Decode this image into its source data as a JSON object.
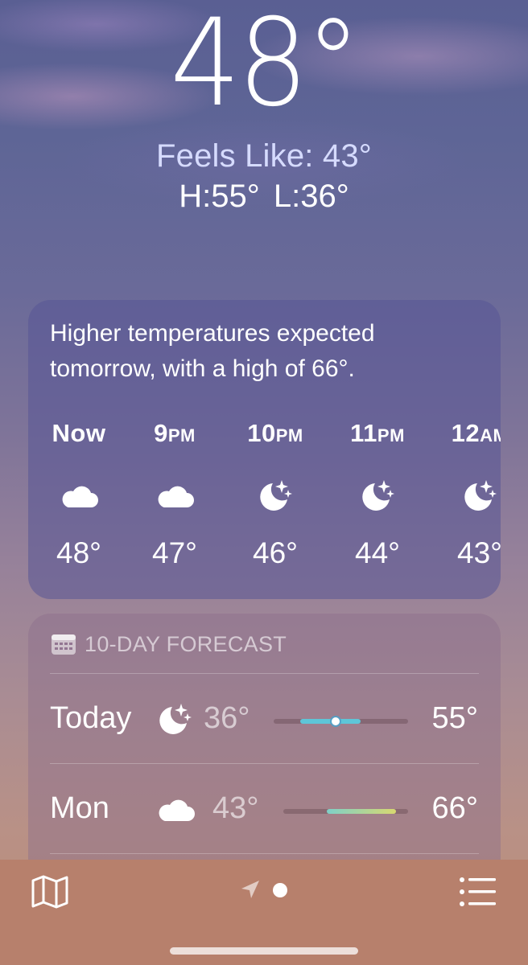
{
  "current": {
    "temperature": "48°",
    "feels_like": "Feels Like: 43°",
    "high_low": "H:55°  L:36°"
  },
  "hourly": {
    "summary": "Higher temperatures expected tomorrow, with a high of 66°.",
    "items": [
      {
        "label": "Now",
        "label_suffix": "",
        "icon": "cloud-icon",
        "temp": "48°"
      },
      {
        "label": "9",
        "label_suffix": "PM",
        "icon": "cloud-icon",
        "temp": "47°"
      },
      {
        "label": "10",
        "label_suffix": "PM",
        "icon": "moon-stars-icon",
        "temp": "46°"
      },
      {
        "label": "11",
        "label_suffix": "PM",
        "icon": "moon-stars-icon",
        "temp": "44°"
      },
      {
        "label": "12",
        "label_suffix": "AM",
        "icon": "moon-stars-icon",
        "temp": "43°"
      }
    ]
  },
  "daily": {
    "header": "10-DAY FORECAST",
    "header_icon": "calendar-icon",
    "days": [
      {
        "name": "Today",
        "icon": "moon-stars-icon",
        "low": "36°",
        "high": "55°",
        "bar_colors": [
          "#5ec6d8",
          "#5ec6d8"
        ],
        "current_marker": true
      },
      {
        "name": "Mon",
        "icon": "cloud-icon",
        "low": "43°",
        "high": "66°",
        "bar_colors": [
          "#7ed0c8",
          "#d8d870"
        ],
        "current_marker": false
      }
    ]
  },
  "tabbar": {
    "map_icon": "map-icon",
    "location_icon": "location-arrow-icon",
    "list_icon": "list-icon"
  }
}
